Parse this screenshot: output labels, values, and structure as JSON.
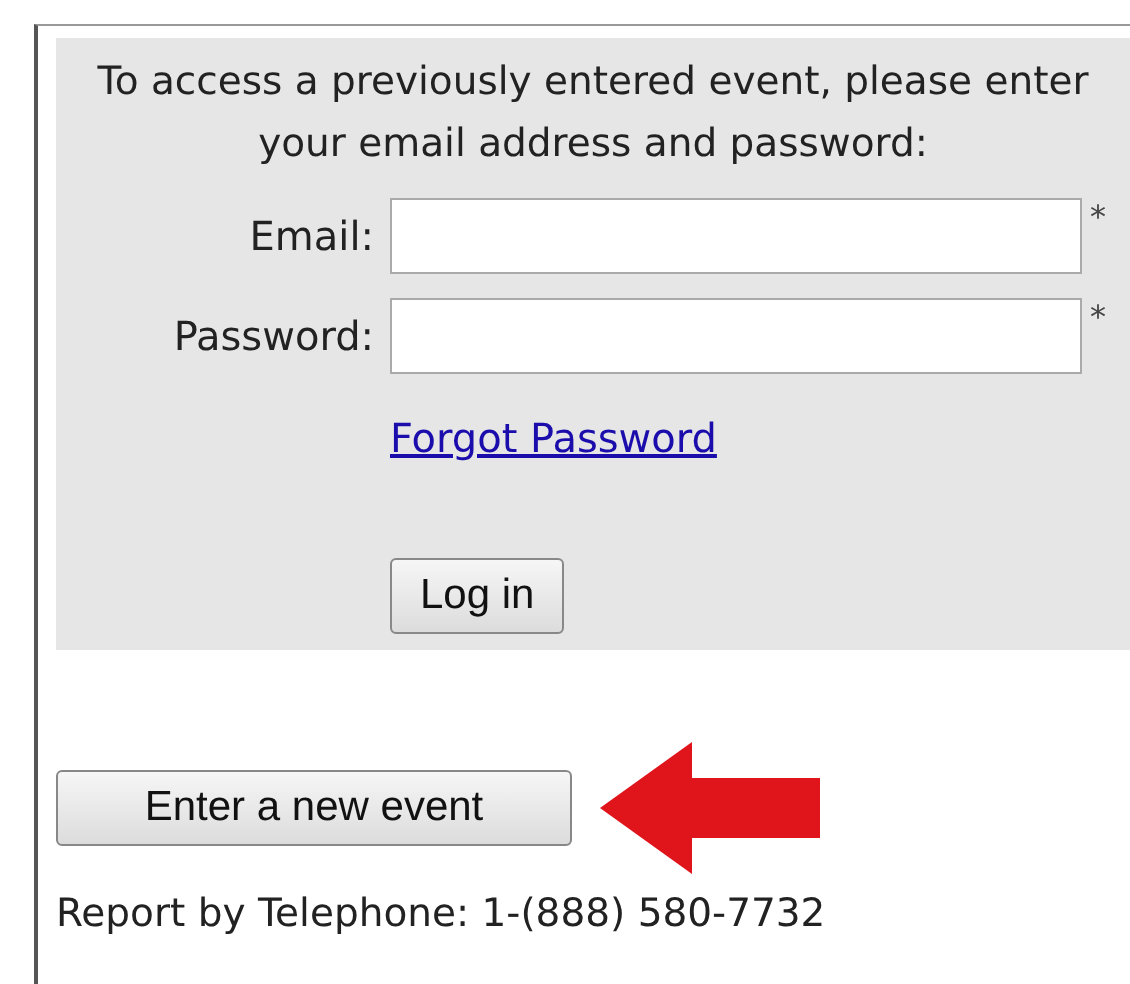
{
  "login_panel": {
    "intro": "To access a previously entered event, please enter your email address and password:",
    "fields": [
      {
        "label": "Email:",
        "required_mark": "*"
      },
      {
        "label": "Password:",
        "required_mark": "*"
      }
    ],
    "forgot_link": "Forgot Password",
    "login_button": "Log in"
  },
  "new_event_button": "Enter a new event",
  "telephone": "Report by Telephone: 1-(888) 580-7732"
}
